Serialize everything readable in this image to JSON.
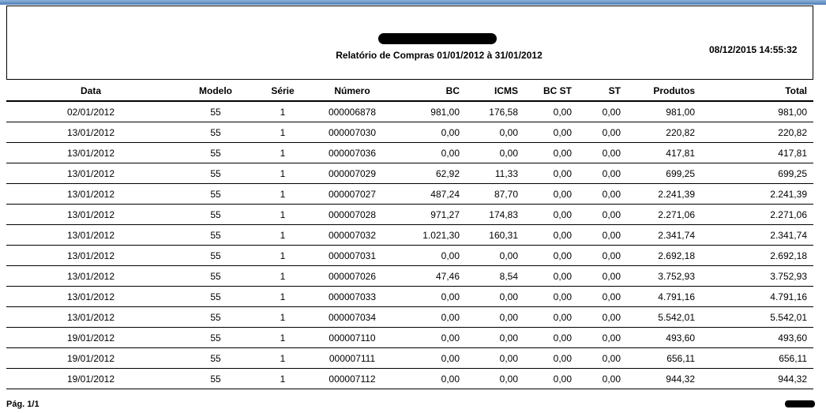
{
  "report": {
    "title": "Relatório de Compras 01/01/2012 à 31/01/2012",
    "timestamp": "08/12/2015 14:55:32"
  },
  "columns": [
    "Data",
    "Modelo",
    "Série",
    "Número",
    "BC",
    "ICMS",
    "BC ST",
    "ST",
    "Produtos",
    "Total"
  ],
  "rows": [
    [
      "02/01/2012",
      "55",
      "1",
      "000006878",
      "981,00",
      "176,58",
      "0,00",
      "0,00",
      "981,00",
      "981,00"
    ],
    [
      "13/01/2012",
      "55",
      "1",
      "000007030",
      "0,00",
      "0,00",
      "0,00",
      "0,00",
      "220,82",
      "220,82"
    ],
    [
      "13/01/2012",
      "55",
      "1",
      "000007036",
      "0,00",
      "0,00",
      "0,00",
      "0,00",
      "417,81",
      "417,81"
    ],
    [
      "13/01/2012",
      "55",
      "1",
      "000007029",
      "62,92",
      "11,33",
      "0,00",
      "0,00",
      "699,25",
      "699,25"
    ],
    [
      "13/01/2012",
      "55",
      "1",
      "000007027",
      "487,24",
      "87,70",
      "0,00",
      "0,00",
      "2.241,39",
      "2.241,39"
    ],
    [
      "13/01/2012",
      "55",
      "1",
      "000007028",
      "971,27",
      "174,83",
      "0,00",
      "0,00",
      "2.271,06",
      "2.271,06"
    ],
    [
      "13/01/2012",
      "55",
      "1",
      "000007032",
      "1.021,30",
      "160,31",
      "0,00",
      "0,00",
      "2.341,74",
      "2.341,74"
    ],
    [
      "13/01/2012",
      "55",
      "1",
      "000007031",
      "0,00",
      "0,00",
      "0,00",
      "0,00",
      "2.692,18",
      "2.692,18"
    ],
    [
      "13/01/2012",
      "55",
      "1",
      "000007026",
      "47,46",
      "8,54",
      "0,00",
      "0,00",
      "3.752,93",
      "3.752,93"
    ],
    [
      "13/01/2012",
      "55",
      "1",
      "000007033",
      "0,00",
      "0,00",
      "0,00",
      "0,00",
      "4.791,16",
      "4.791,16"
    ],
    [
      "13/01/2012",
      "55",
      "1",
      "000007034",
      "0,00",
      "0,00",
      "0,00",
      "0,00",
      "5.542,01",
      "5.542,01"
    ],
    [
      "19/01/2012",
      "55",
      "1",
      "000007110",
      "0,00",
      "0,00",
      "0,00",
      "0,00",
      "493,60",
      "493,60"
    ],
    [
      "19/01/2012",
      "55",
      "1",
      "000007111",
      "0,00",
      "0,00",
      "0,00",
      "0,00",
      "656,11",
      "656,11"
    ],
    [
      "19/01/2012",
      "55",
      "1",
      "000007112",
      "0,00",
      "0,00",
      "0,00",
      "0,00",
      "944,32",
      "944,32"
    ]
  ],
  "footer": {
    "page": "Pág. 1/1"
  }
}
